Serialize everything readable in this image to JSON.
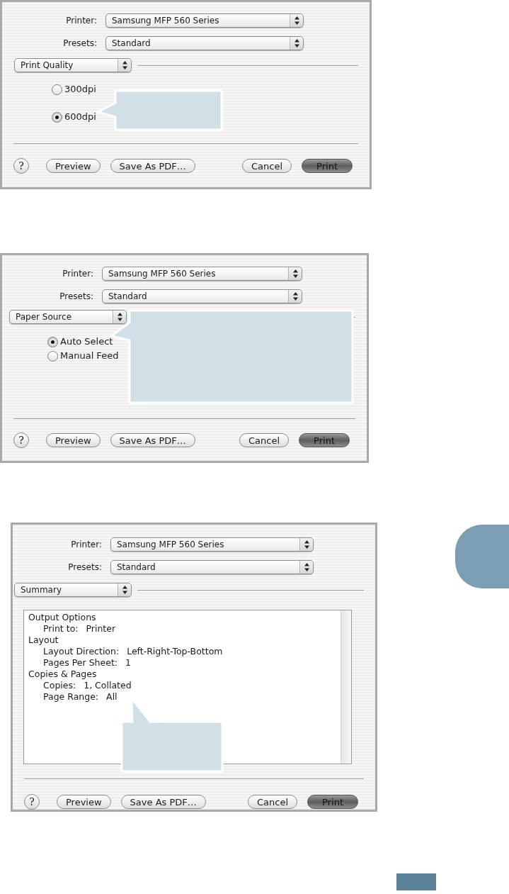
{
  "dialogs": [
    {
      "fields": [
        {
          "label": "Printer:",
          "value": "Samsung MFP 560 Series"
        },
        {
          "label": "Presets:",
          "value": "Standard"
        }
      ],
      "panel": "Print Quality",
      "content": {
        "kind": "radios",
        "options": [
          {
            "label": "300dpi",
            "selected": false
          },
          {
            "label": "600dpi",
            "selected": true
          }
        ]
      },
      "buttons": [
        {
          "label": "?",
          "kind": "help"
        },
        {
          "label": "Preview",
          "kind": "plain"
        },
        {
          "label": "Save As PDF…",
          "kind": "plain"
        },
        {
          "label": "Cancel",
          "kind": "plain"
        },
        {
          "label": "Print",
          "kind": "default"
        }
      ]
    },
    {
      "fields": [
        {
          "label": "Printer:",
          "value": "Samsung MFP 560 Series"
        },
        {
          "label": "Presets:",
          "value": "Standard"
        }
      ],
      "panel": "Paper Source",
      "content": {
        "kind": "radios",
        "options": [
          {
            "label": "Auto Select",
            "selected": true
          },
          {
            "label": "Manual Feed",
            "selected": false
          }
        ]
      },
      "buttons": [
        {
          "label": "?",
          "kind": "help"
        },
        {
          "label": "Preview",
          "kind": "plain"
        },
        {
          "label": "Save As PDF…",
          "kind": "plain"
        },
        {
          "label": "Cancel",
          "kind": "plain"
        },
        {
          "label": "Print",
          "kind": "default"
        }
      ]
    },
    {
      "fields": [
        {
          "label": "Printer:",
          "value": "Samsung MFP 560 Series"
        },
        {
          "label": "Presets:",
          "value": "Standard"
        }
      ],
      "panel": "Summary",
      "content": {
        "kind": "summary",
        "groups": [
          {
            "heading": "Output Options",
            "items": [
              {
                "label": "Print to:",
                "value": "Printer"
              }
            ]
          },
          {
            "heading": "Layout",
            "items": [
              {
                "label": "Layout Direction:",
                "value": "Left-Right-Top-Bottom"
              },
              {
                "label": "Pages Per Sheet:",
                "value": "1"
              }
            ]
          },
          {
            "heading": "Copies & Pages",
            "items": [
              {
                "label": "Copies:",
                "value": "1, Collated"
              },
              {
                "label": "Page Range:",
                "value": "All"
              }
            ]
          }
        ]
      },
      "buttons": [
        {
          "label": "?",
          "kind": "help"
        },
        {
          "label": "Preview",
          "kind": "plain"
        },
        {
          "label": "Save As PDF…",
          "kind": "plain"
        },
        {
          "label": "Cancel",
          "kind": "plain"
        },
        {
          "label": "Print",
          "kind": "default"
        }
      ]
    }
  ]
}
